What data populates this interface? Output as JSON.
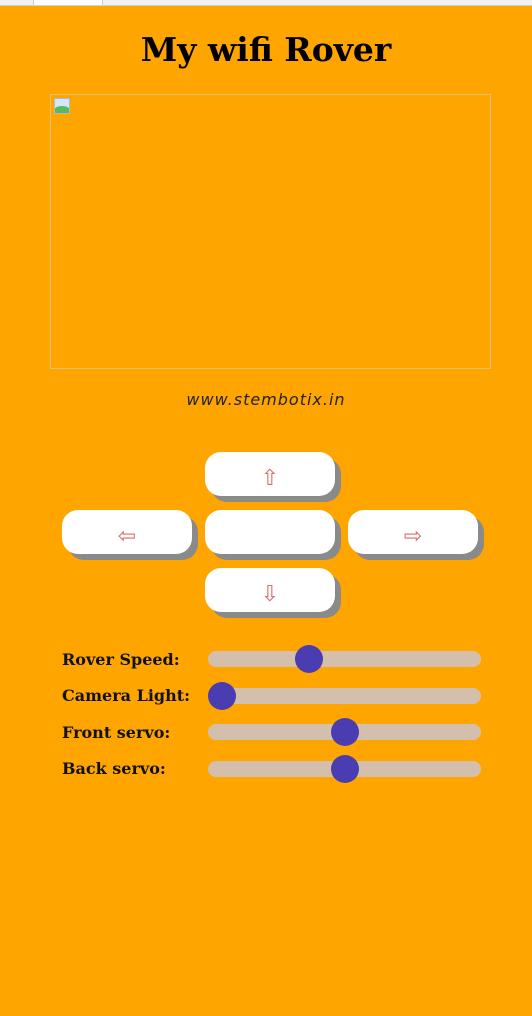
{
  "page": {
    "title": "My wifi Rover",
    "website": "www.stembotix.in"
  },
  "controls": {
    "up": "⇧",
    "left": "⇦",
    "stop": "",
    "right": "⇨",
    "down": "⇩"
  },
  "sliders": [
    {
      "label": "Rover Speed:",
      "value": 0.37
    },
    {
      "label": "Camera Light:",
      "value": 0.05
    },
    {
      "label": "Front servo:",
      "value": 0.5
    },
    {
      "label": "Back servo:",
      "value": 0.5
    }
  ],
  "colors": {
    "background": "#FFA500",
    "slider_thumb": "#4a3cb1",
    "slider_track": "#d3bfac",
    "arrow": "#e26a6a"
  },
  "icons": {
    "camera_stream": "broken-image-icon"
  }
}
